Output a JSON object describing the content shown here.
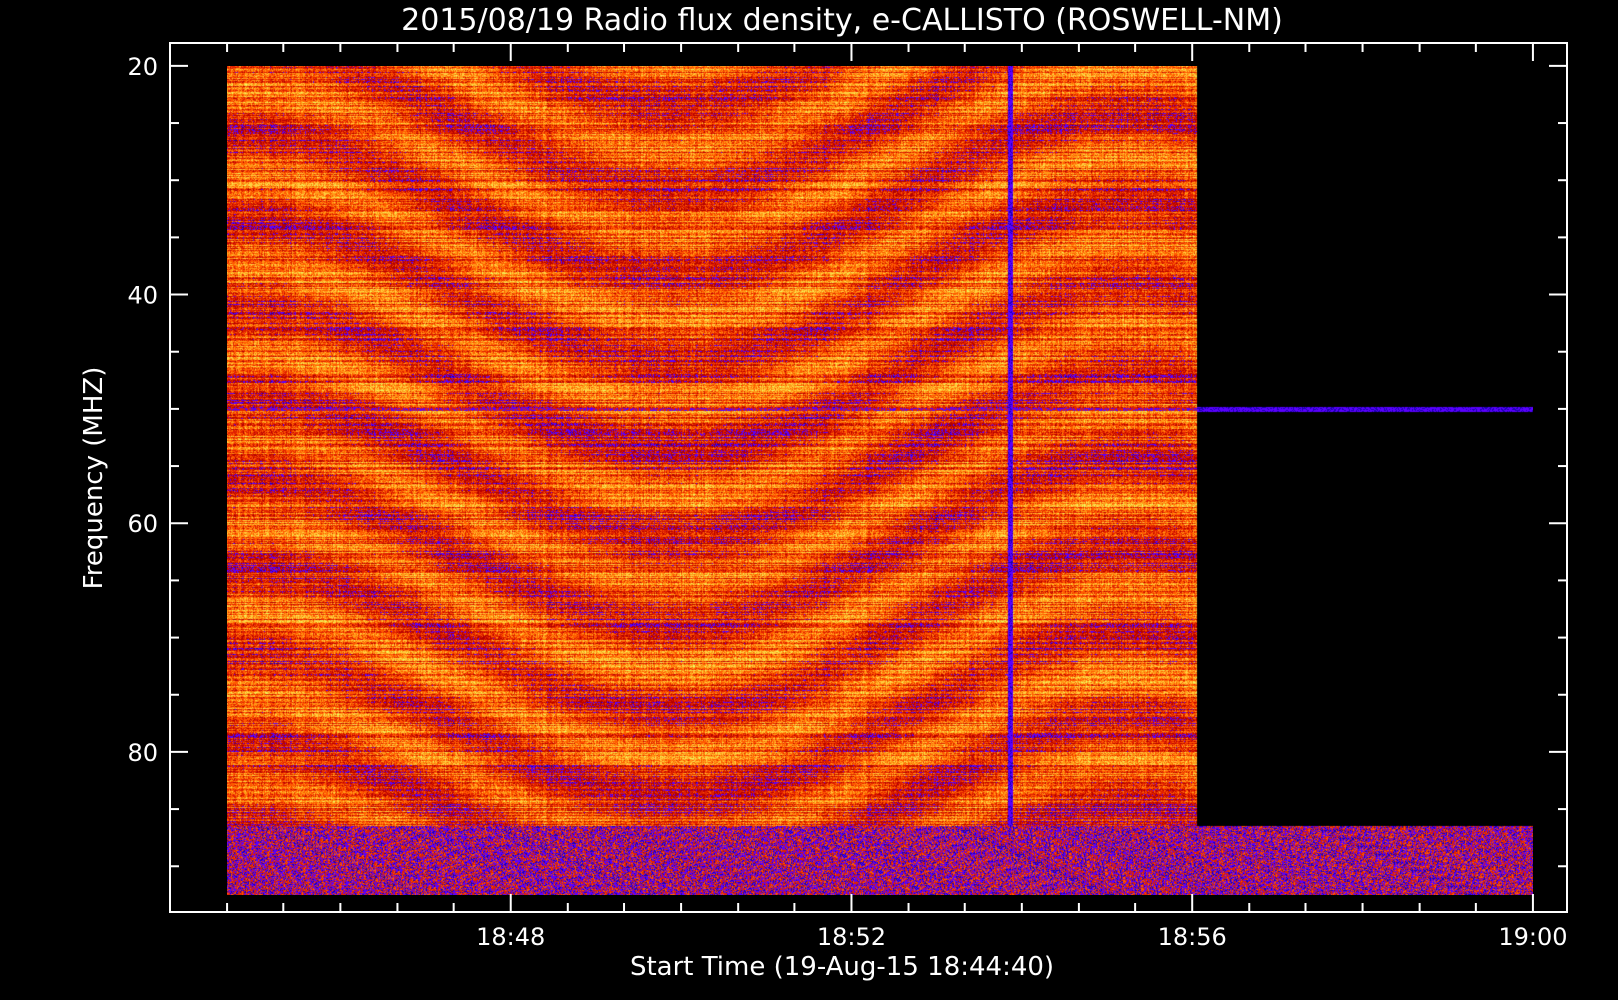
{
  "chart_data": {
    "type": "heatmap",
    "title": "2015/08/19  Radio flux density, e-CALLISTO (ROSWELL-NM)",
    "xlabel": "Start Time (19-Aug-15 18:44:40)",
    "ylabel": "Frequency (MHZ)",
    "x_unit": "time (UT, minutes after 18:00)",
    "y_unit": "MHz",
    "xlim": [
      44.0,
      60.4
    ],
    "ylim": [
      18,
      94
    ],
    "y_inverted": true,
    "x_major_ticks": [
      {
        "value": 48,
        "label": "18:48"
      },
      {
        "value": 52,
        "label": "18:52"
      },
      {
        "value": 56,
        "label": "18:56"
      },
      {
        "value": 60,
        "label": "19:00"
      }
    ],
    "x_minor_ticks": [
      44.67,
      45.33,
      46,
      46.67,
      47.33,
      48.67,
      49.33,
      50,
      50.67,
      51.33,
      52.67,
      53.33,
      54,
      54.67,
      55.33,
      56.67,
      57.33,
      58,
      58.67,
      59.33
    ],
    "y_major_ticks": [
      {
        "value": 20,
        "label": "20"
      },
      {
        "value": 40,
        "label": "40"
      },
      {
        "value": 60,
        "label": "60"
      },
      {
        "value": 80,
        "label": "80"
      }
    ],
    "y_minor_ticks": [
      25,
      30,
      35,
      45,
      50,
      55,
      65,
      70,
      75,
      85,
      90
    ],
    "data_extent": {
      "t_start": 44.67,
      "t_end": 60.0,
      "f_min": 20,
      "f_max": 92.5
    },
    "data_gap": {
      "t_start": 56.06,
      "t_end": 60.0,
      "f_min": 20,
      "f_max": 86.5
    },
    "spectral_features": [
      {
        "kind": "vertical_burst",
        "t": 53.86,
        "note": "blue interference line across all frequencies"
      },
      {
        "kind": "horizontal_band",
        "f": 50.0,
        "note": "persistent narrow-band line"
      },
      {
        "kind": "low_signal_band",
        "f_min": 86.5,
        "f_max": 92.5,
        "note": "blue/red noisy band at bottom"
      }
    ],
    "colormap": [
      "#000000",
      "#1a00b0",
      "#5a00ff",
      "#b40000",
      "#e02000",
      "#ff5a00",
      "#ff9a18",
      "#ffd040",
      "#e8ff60"
    ],
    "grid": false
  }
}
